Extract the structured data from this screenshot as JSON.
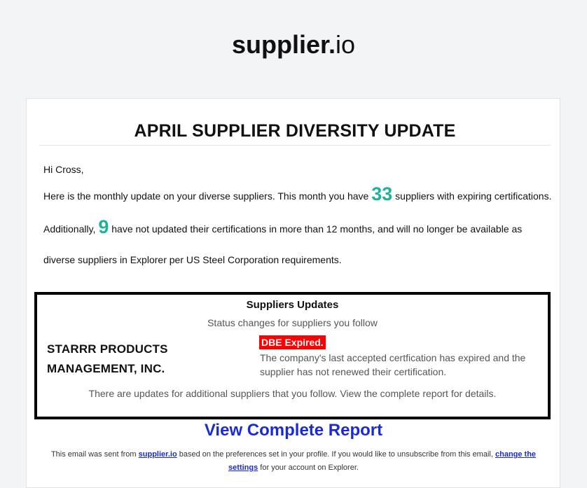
{
  "brand": {
    "name_bold": "supplier.",
    "name_light": "io"
  },
  "email": {
    "heading": "APRIL SUPPLIER DIVERSITY UPDATE",
    "greeting": "Hi Cross,",
    "para_1": "Here is the monthly update on your diverse suppliers. This month you have",
    "expiring_count": "33",
    "para_2": "suppliers with expiring certifications. Additionally,",
    "stale_count": "9",
    "para_3": "have not updated their certifications in more than 12 months, and will no longer be available as diverse suppliers in Explorer per US Steel Corporation requirements."
  },
  "updates": {
    "title": "Suppliers Updates",
    "subtitle": "Status changes for suppliers you follow",
    "supplier_name": "STARRR PRODUCTS MANAGEMENT, INC.",
    "status_badge": "DBE Expired.",
    "status_desc": "The company's last accepted certfication has expired and the supplier has not renewed their certification.",
    "note": "There are updates for additional suppliers that you follow. View the complete report for details."
  },
  "cta": {
    "label": "View Complete Report"
  },
  "footer": {
    "text_1": "This email was sent from",
    "link_1": "supplier.io",
    "text_2": "based on the preferences set in your profile. If you would like to unsubscribe from this email,",
    "link_2": "change the settings",
    "text_3": "for your account on Explorer."
  },
  "colors": {
    "accent_number": "#1fb29a",
    "link": "#1a2bd6",
    "badge": "#ff0000"
  }
}
